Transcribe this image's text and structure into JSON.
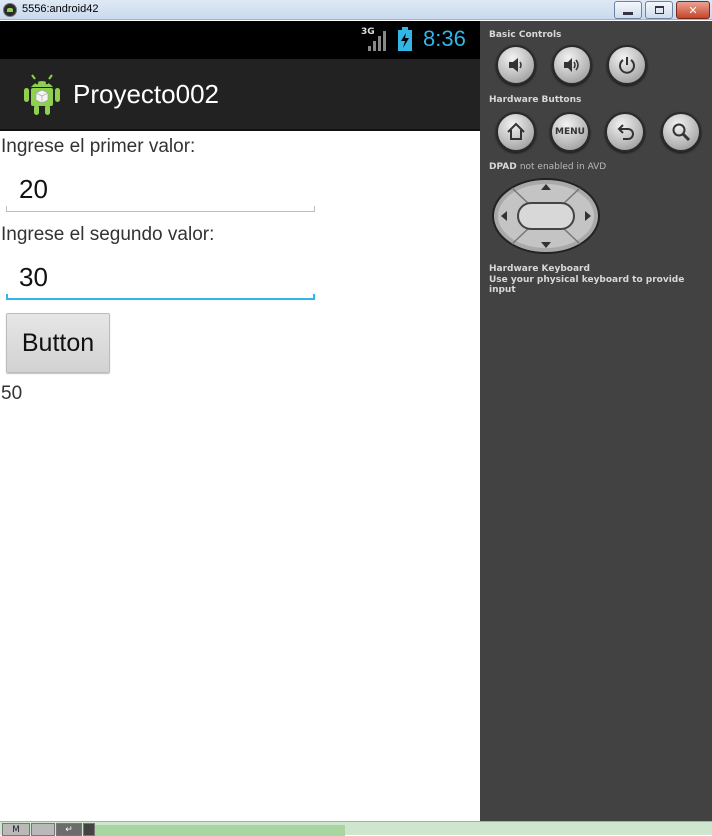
{
  "window": {
    "title": "5556:android42"
  },
  "status_bar": {
    "network": "3G",
    "time": "8:36",
    "clock_color": "#33b5e5"
  },
  "action_bar": {
    "app_title": "Proyecto002",
    "icon": "android-robot-icon"
  },
  "form": {
    "label_first": "Ingrese el primer valor:",
    "value_first": "20",
    "label_second": "Ingrese el segundo valor:",
    "value_second": "30",
    "button_label": "Button",
    "result": "50"
  },
  "control_panel": {
    "basic_controls_title": "Basic Controls",
    "basic_controls": [
      {
        "icon": "volume-down-icon"
      },
      {
        "icon": "volume-up-icon"
      },
      {
        "icon": "power-icon"
      }
    ],
    "hardware_buttons_title": "Hardware Buttons",
    "hardware_buttons": [
      {
        "icon": "home-icon"
      },
      {
        "label": "MENU"
      },
      {
        "icon": "back-icon"
      },
      {
        "icon": "search-icon"
      }
    ],
    "dpad_title": "DPAD",
    "dpad_note": "not enabled in AVD",
    "keyboard_title": "Hardware Keyboard",
    "keyboard_note": "Use your physical keyboard to provide input"
  },
  "taskbar": {
    "key1": "M"
  },
  "colors": {
    "accent": "#33b5e5",
    "action_bar": "#222222",
    "panel": "#424242"
  }
}
